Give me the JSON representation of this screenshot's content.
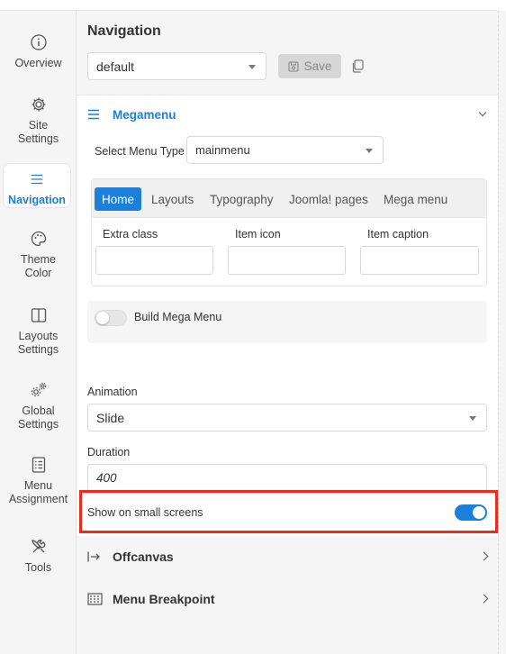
{
  "sidebar": {
    "items": [
      {
        "label": "Overview",
        "icon": "info-icon"
      },
      {
        "label": "Site Settings",
        "icon": "gear-icon"
      },
      {
        "label": "Navigation",
        "icon": "menu-icon"
      },
      {
        "label": "Theme Color",
        "icon": "palette-icon"
      },
      {
        "label": "Layouts Settings",
        "icon": "layout-icon"
      },
      {
        "label": "Global Settings",
        "icon": "gears-icon"
      },
      {
        "label": "Menu Assignment",
        "icon": "checklist-icon"
      },
      {
        "label": "Tools",
        "icon": "tools-icon"
      }
    ],
    "active_color": "#1a80d9"
  },
  "header": {
    "title": "Navigation",
    "preset_value": "default",
    "save_label": "Save"
  },
  "megamenu": {
    "title": "Megamenu",
    "menu_type_label": "Select Menu Type",
    "menu_type_value": "mainmenu",
    "tabs": [
      "Home",
      "Layouts",
      "Typography",
      "Joomla! pages",
      "Mega menu"
    ],
    "fields": [
      "Extra class",
      "Item icon",
      "Item caption"
    ],
    "build_label": "Build Mega Menu",
    "animation_label": "Animation",
    "animation_value": "Slide",
    "duration_label": "Duration",
    "duration_value": "400",
    "small_screens_label": "Show on small screens"
  },
  "offcanvas": {
    "title": "Offcanvas"
  },
  "breakpoint": {
    "title": "Menu Breakpoint"
  },
  "colors": {
    "accent": "#1a80d9",
    "highlight": "#ee2a1a"
  }
}
